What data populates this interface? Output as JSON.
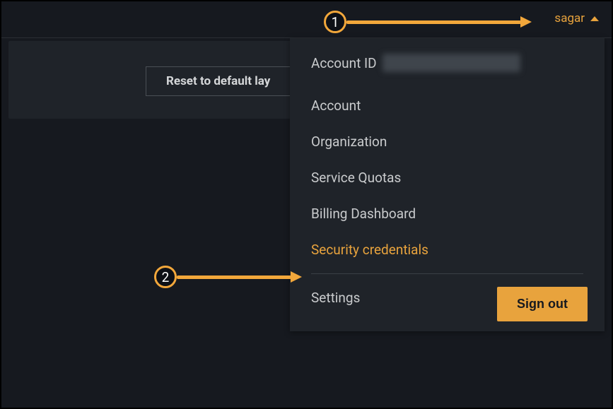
{
  "header": {
    "username": "sagar"
  },
  "toolbar": {
    "reset_label": "Reset to default lay"
  },
  "dropdown": {
    "account_id_label": "Account ID",
    "items": [
      "Account",
      "Organization",
      "Service Quotas",
      "Billing Dashboard",
      "Security credentials"
    ],
    "settings_label": "Settings",
    "sign_out_label": "Sign out"
  },
  "annotations": {
    "one": "1",
    "two": "2"
  },
  "colors": {
    "accent": "#e8a33d",
    "bg_dark": "#16191f",
    "bg_panel": "#1f2329"
  }
}
